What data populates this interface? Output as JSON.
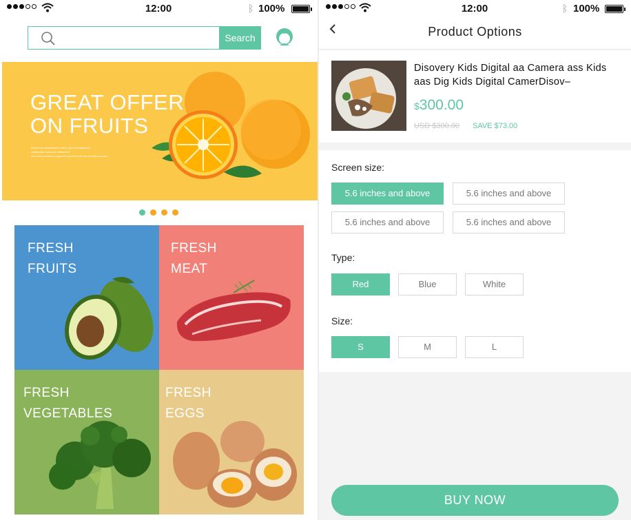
{
  "left_status": {
    "time": "12:00",
    "battery": "100%"
  },
  "right_status": {
    "time": "12:00",
    "battery": "100%"
  },
  "search": {
    "placeholder": "",
    "button_label": "Search"
  },
  "banner": {
    "title_line1": "GREAT OFFERS",
    "title_line2": "ON FRUITS",
    "subtitle_line1": "Fresh fruit established a full project management",
    "subtitle_line2": "systematic customer settlement",
    "subtitle_line3": "and direct-entrance segment stocked with time-trending assets"
  },
  "carousel_dots": [
    "#5ec6a3",
    "#f5a623",
    "#f5a623",
    "#f5a623"
  ],
  "categories": [
    {
      "line1": "FRESH",
      "line2": "FRUITS",
      "color": "#4b94cf"
    },
    {
      "line1": "FRESH",
      "line2": "MEAT",
      "color": "#f18078"
    },
    {
      "line1": "FRESH",
      "line2": "VEGETABLES",
      "color": "#8ab35a"
    },
    {
      "line1": "FRESH",
      "line2": "EGGS",
      "color": "#e8cb8a"
    }
  ],
  "nav": {
    "title": "Product Options"
  },
  "product": {
    "name": "Disovery Kids Digital aa Camera ass Kids aas Dig Kids Digital CamerDisov–",
    "currency": "$",
    "price": "300.00",
    "old_price": "USD $300.00",
    "save": "SAVE $73.00"
  },
  "screen_size": {
    "label": "Screen size:",
    "options": [
      "5.6 inches and above",
      "5.6 inches and above",
      "5.6 inches and above",
      "5.6 inches and above"
    ],
    "selected": 0
  },
  "type": {
    "label": "Type:",
    "options": [
      "Red",
      "Blue",
      "White"
    ],
    "selected": 0
  },
  "size": {
    "label": "Size:",
    "options": [
      "S",
      "M",
      "L"
    ],
    "selected": 0
  },
  "buy_label": "BUY NOW",
  "colors": {
    "accent": "#5ec6a3",
    "banner": "#fcc84a",
    "dot_inactive": "#f5a623"
  }
}
